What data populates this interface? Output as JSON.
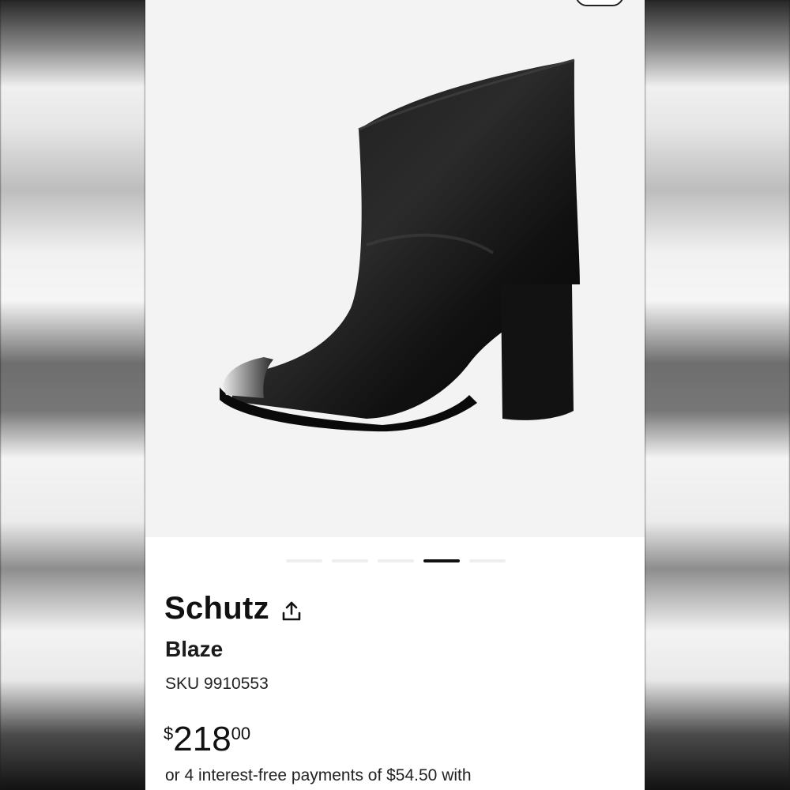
{
  "product": {
    "brand": "Schutz",
    "model": "Blaze",
    "sku": "SKU 9910553",
    "price": {
      "currency": "$",
      "dollars": "218",
      "cents": "00"
    },
    "installments_text": "or 4 interest-free payments of $54.50 with"
  },
  "carousel": {
    "total_slides": 5,
    "active_index": 3
  },
  "icons": {
    "share": "share-upload-icon"
  },
  "colors": {
    "text": "#111111",
    "image_bg": "#f3f3f3",
    "dot_active": "#111111",
    "dot_inactive": "#eeeeee"
  }
}
